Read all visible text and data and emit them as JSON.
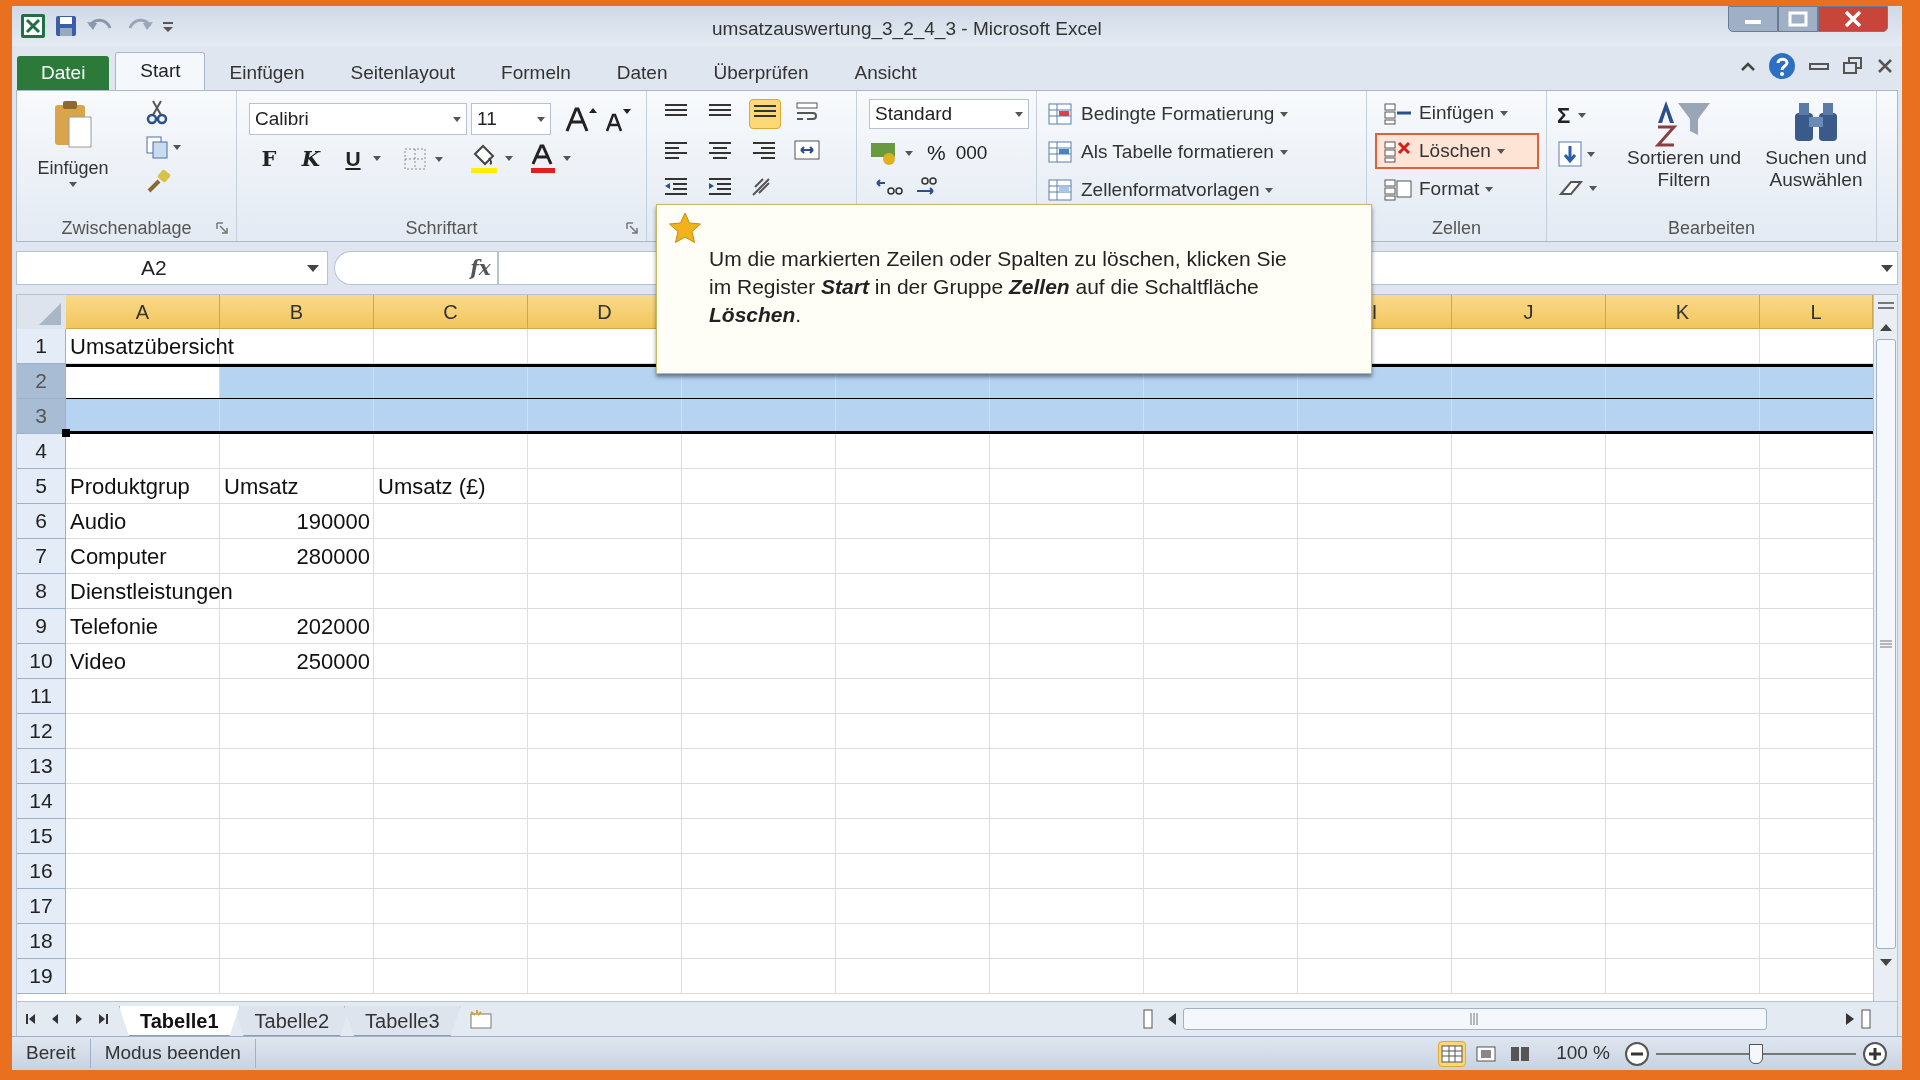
{
  "window": {
    "title": "umsatzauswertung_3_2_4_3 - Microsoft Excel"
  },
  "ribbon_tabs": [
    {
      "label": "Datei",
      "kind": "file",
      "selected": false
    },
    {
      "label": "Start",
      "kind": "tab",
      "selected": true
    },
    {
      "label": "Einfügen",
      "kind": "tab",
      "selected": false
    },
    {
      "label": "Seitenlayout",
      "kind": "tab",
      "selected": false
    },
    {
      "label": "Formeln",
      "kind": "tab",
      "selected": false
    },
    {
      "label": "Daten",
      "kind": "tab",
      "selected": false
    },
    {
      "label": "Überprüfen",
      "kind": "tab",
      "selected": false
    },
    {
      "label": "Ansicht",
      "kind": "tab",
      "selected": false
    }
  ],
  "clipboard": {
    "paste": "Einfügen",
    "group": "Zwischenablage"
  },
  "font": {
    "name": "Calibri",
    "size": "11",
    "bold": "F",
    "italic": "K",
    "underline": "U",
    "group": "Schriftart"
  },
  "number": {
    "format": "Standard",
    "percent": "%",
    "thousands": "000"
  },
  "styles": [
    "Bedingte Formatierung",
    "Als Tabelle formatieren",
    "Zellenformatvorlagen"
  ],
  "cells_group": {
    "group": "Zellen",
    "items": [
      {
        "label": "Einfügen",
        "selected": false
      },
      {
        "label": "Löschen",
        "selected": true
      },
      {
        "label": "Format",
        "selected": false
      }
    ]
  },
  "editing": {
    "sum": "Σ",
    "sort": "Sortieren und Filtern",
    "find": "Suchen und Auswählen",
    "group": "Bearbeiten"
  },
  "formula_bar": {
    "name_box": "A2",
    "fx": "fx"
  },
  "tooltip": {
    "text": "Um die markierten Zeilen oder Spalten zu löschen, klicken Sie im Register **Start** in der Gruppe **Zellen** auf die Schaltfläche **Löschen**."
  },
  "sheet": {
    "columns": [
      {
        "label": "A"
      },
      {
        "label": "B"
      },
      {
        "label": "C"
      },
      {
        "label": "D"
      },
      {},
      {},
      {},
      {},
      {
        "label": "I"
      },
      {
        "label": "J"
      },
      {
        "label": "K"
      },
      {
        "label": "L"
      }
    ],
    "rows": [
      {
        "label": "1",
        "selected": false,
        "cells": [
          {
            "text": "Umsatzübersicht",
            "kind": "text"
          }
        ]
      },
      {
        "label": "2",
        "selected": true,
        "active": true,
        "cells": []
      },
      {
        "label": "3",
        "selected": true,
        "cells": []
      },
      {
        "label": "4",
        "selected": false,
        "cells": []
      },
      {
        "label": "5",
        "selected": false,
        "cells": [
          {
            "text": "Produktgrup",
            "kind": "text"
          },
          {
            "text": "Umsatz",
            "kind": "text"
          },
          {
            "text": "Umsatz (£)",
            "kind": "text"
          }
        ]
      },
      {
        "label": "6",
        "selected": false,
        "cells": [
          {
            "text": "Audio",
            "kind": "text"
          },
          {
            "text": "190000",
            "kind": "number"
          }
        ]
      },
      {
        "label": "7",
        "selected": false,
        "cells": [
          {
            "text": "Computer",
            "kind": "text"
          },
          {
            "text": "280000",
            "kind": "number"
          }
        ]
      },
      {
        "label": "8",
        "selected": false,
        "cells": [
          {
            "text": "Dienstleistungen",
            "kind": "text"
          }
        ]
      },
      {
        "label": "9",
        "selected": false,
        "cells": [
          {
            "text": "Telefonie",
            "kind": "text"
          },
          {
            "text": "202000",
            "kind": "number"
          }
        ]
      },
      {
        "label": "10",
        "selected": false,
        "cells": [
          {
            "text": "Video",
            "kind": "text"
          },
          {
            "text": "250000",
            "kind": "number"
          }
        ]
      },
      {
        "label": "11",
        "selected": false,
        "cells": []
      },
      {
        "label": "12",
        "selected": false,
        "cells": []
      },
      {
        "label": "13",
        "selected": false,
        "cells": []
      },
      {
        "label": "14",
        "selected": false,
        "cells": []
      },
      {
        "label": "15",
        "selected": false,
        "cells": []
      },
      {
        "label": "16",
        "selected": false,
        "cells": []
      },
      {
        "label": "17",
        "selected": false,
        "cells": []
      },
      {
        "label": "18",
        "selected": false,
        "cells": []
      },
      {
        "label": "19",
        "selected": false,
        "cells": []
      }
    ]
  },
  "sheet_tabs": [
    {
      "label": "Tabelle1",
      "selected": true
    },
    {
      "label": "Tabelle2",
      "selected": false
    },
    {
      "label": "Tabelle3",
      "selected": false
    }
  ],
  "status_bar": {
    "items": [
      "Bereit",
      "Modus beenden"
    ],
    "views": [
      {
        "kind": "normal",
        "selected": true
      },
      {
        "kind": "layout",
        "selected": false
      },
      {
        "kind": "break",
        "selected": false
      }
    ],
    "zoom": "100 %",
    "zoom_slider": {
      "level": 0.5
    }
  }
}
